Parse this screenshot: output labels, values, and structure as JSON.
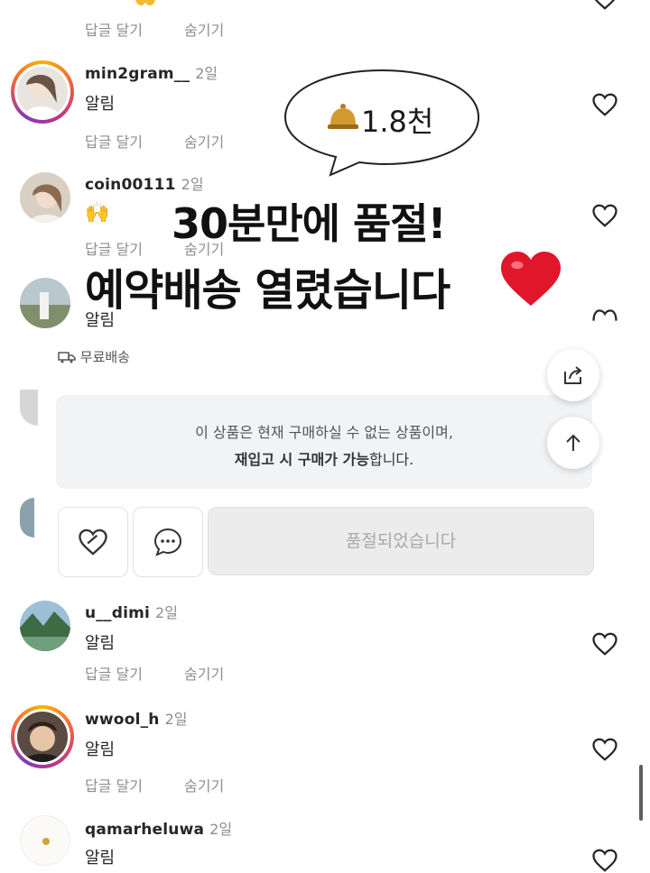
{
  "comments": [
    {
      "username": "min2gram__",
      "time": "2일",
      "text": "알림",
      "reply": "답글 달기",
      "hide": "숨기기"
    },
    {
      "username": "coin00111",
      "time": "2일",
      "text": "🙌",
      "reply": "답글 달기",
      "hide": "숨기기"
    },
    {
      "username": "",
      "time": "",
      "text": "알림",
      "reply": "",
      "hide": ""
    },
    {
      "username": "u__dimi",
      "time": "2일",
      "text": "알림",
      "reply": "답글 달기",
      "hide": "숨기기"
    },
    {
      "username": "wwool_h",
      "time": "2일",
      "text": "알림",
      "reply": "답글 달기",
      "hide": "숨기기"
    },
    {
      "username": "qamarheluwa",
      "time": "2일",
      "text": "알림",
      "reply": "",
      "hide": ""
    }
  ],
  "top_partial": {
    "reply": "답글 달기",
    "hide": "숨기기"
  },
  "bubble": {
    "text": "1.8천",
    "icon": "bell-icon"
  },
  "overlay": {
    "line1": "30분만에 품절!",
    "line2": "예약배송 열렸습니다"
  },
  "free_shipping": {
    "label": "무료배송",
    "icon": "truck-icon"
  },
  "notice": {
    "line1": "이 상품은 현재 구매하실 수 없는 상품이며,",
    "line2_bold": "재입고 시 구매가 가능",
    "line2_rest": "합니다."
  },
  "buttons": {
    "soldout": "품절되었습니다",
    "like_icon": "heart-icon",
    "chat_icon": "chat-icon",
    "share_icon": "share-icon",
    "top_icon": "arrow-up-icon"
  },
  "colors": {
    "ring_start": "#f7b500",
    "ring_end": "#833ab4",
    "heart_emoji": "#e0162b",
    "bell": "#c8922a"
  }
}
